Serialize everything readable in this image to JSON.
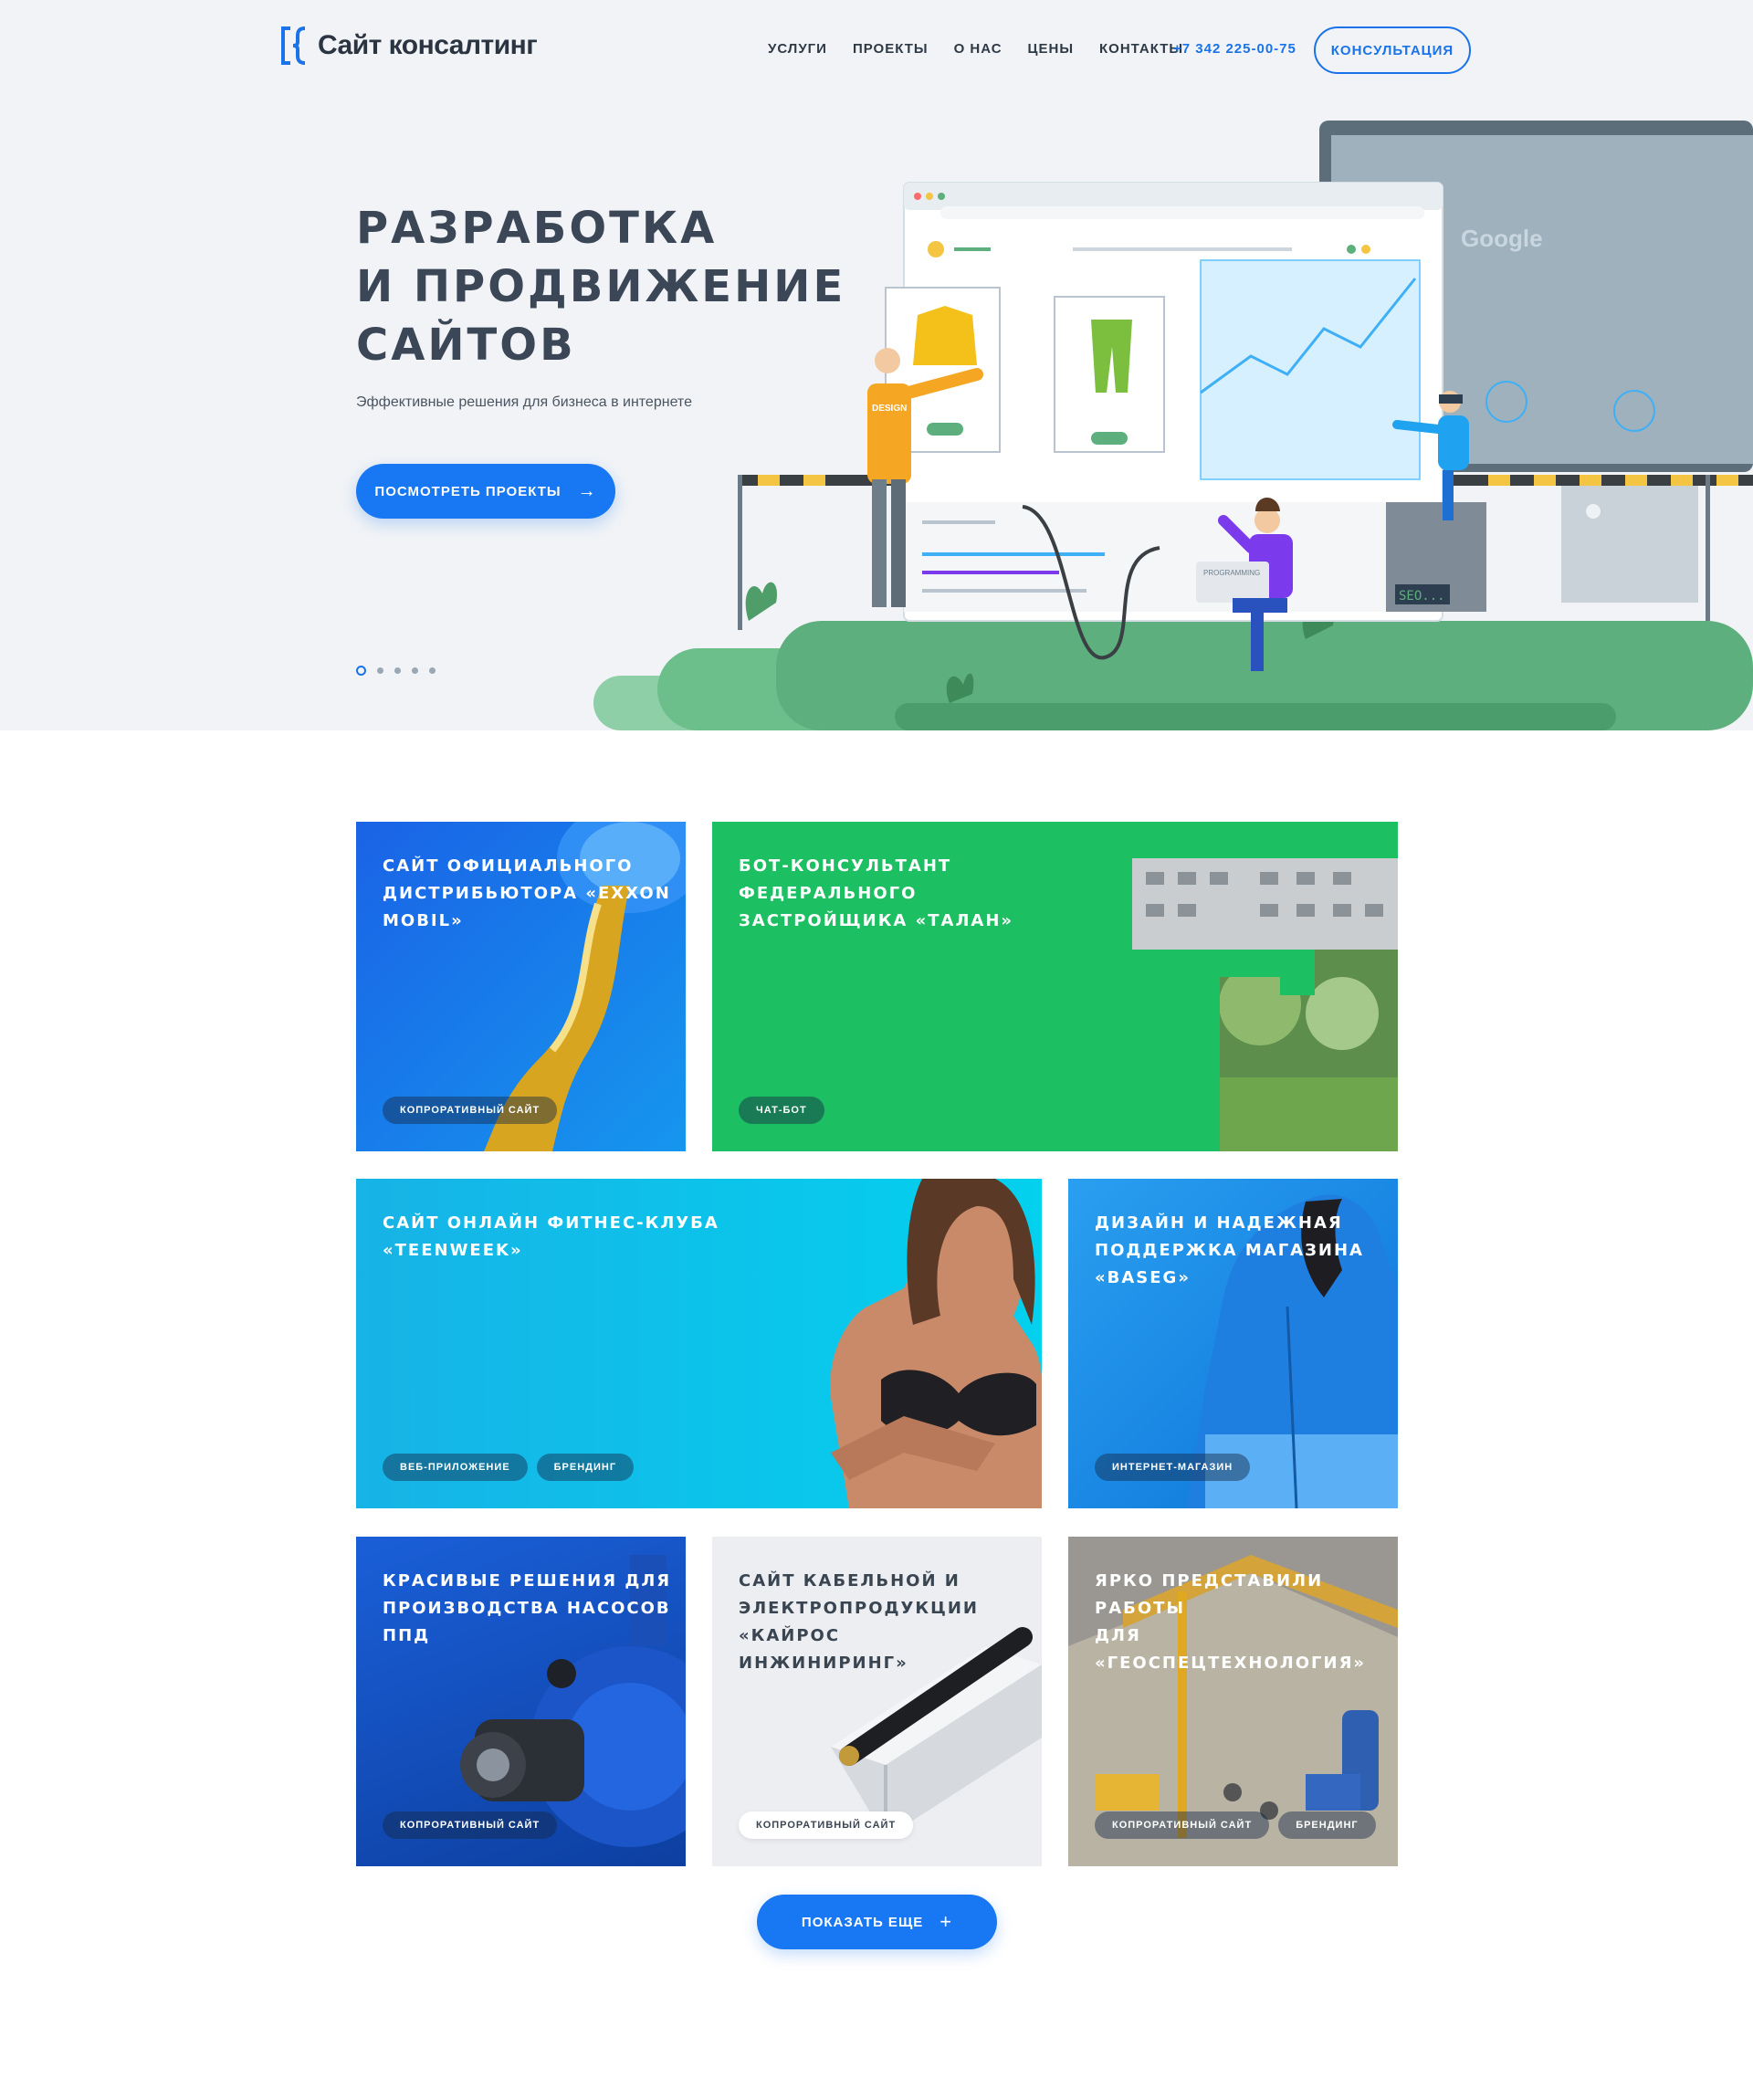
{
  "header": {
    "logo_text": "Сайт консалтинг",
    "nav": [
      "УСЛУГИ",
      "ПРОЕКТЫ",
      "О НАС",
      "ЦЕНЫ",
      "КОНТАКТЫ"
    ],
    "phone": "+7 342 225-00-75",
    "consult_label": "КОНСУЛЬТАЦИЯ"
  },
  "hero": {
    "title_lines": [
      "РАЗРАБОТКА",
      "И ПРОДВИЖЕНИЕ",
      "САЙТОВ"
    ],
    "subtitle": "Эффективные решения для бизнеса в интернете",
    "cta_label": "ПОСМОТРЕТЬ ПРОЕКТЫ",
    "slides_total": 5,
    "active_slide": 1,
    "illustration_text": {
      "shirt_label": "DESIGN",
      "laptop_label": "PROGRAMMING",
      "seo_label": "SEO...",
      "search_brand": "Google"
    }
  },
  "projects": [
    {
      "title": "САЙТ ОФИЦИАЛЬНОГО\nДИСТРИБЬЮТОРА «EXXON\nMOBIL»",
      "tags": [
        "КОПРОРАТИВНЫЙ САЙТ"
      ]
    },
    {
      "title": "БОТ-КОНСУЛЬТАНТ\nФЕДЕРАЛЬНОГО\nЗАСТРОЙЩИКА «ТАЛАН»",
      "tags": [
        "ЧАТ-БОТ"
      ]
    },
    {
      "title": "САЙТ ОНЛАЙН ФИТНЕС-КЛУБА\n«TEENWEEK»",
      "tags": [
        "ВЕБ-ПРИЛОЖЕНИЕ",
        "БРЕНДИНГ"
      ]
    },
    {
      "title": "ДИЗАЙН И НАДЕЖНАЯ\nПОДДЕРЖКА МАГАЗИНА\n«BASEG»",
      "tags": [
        "ИНТЕРНЕТ-МАГАЗИН"
      ]
    },
    {
      "title": "КРАСИВЫЕ РЕШЕНИЯ ДЛЯ\nПРОИЗВОДСТВА НАСОСОВ ППД",
      "tags": [
        "КОПРОРАТИВНЫЙ САЙТ"
      ]
    },
    {
      "title": "САЙТ КАБЕЛЬНОЙ И\nЭЛЕКТРОПРОДУКЦИИ «КАЙРОС\nИНЖИНИРИНГ»",
      "tags": [
        "КОПРОРАТИВНЫЙ САЙТ"
      ]
    },
    {
      "title": "ЯРКО ПРЕДСТАВИЛИ РАБОТЫ\nДЛЯ «ГЕОСПЕЦТЕХНОЛОГИЯ»",
      "tags": [
        "КОПРОРАТИВНЫЙ САЙТ",
        "БРЕНДИНГ"
      ]
    }
  ],
  "more_label": "ПОКАЗАТЬ ЕЩЕ",
  "colors": {
    "accent": "#1877f2",
    "hero_bg": "#f1f3f6",
    "green": "#1cbf61",
    "text_dark": "#3b4756"
  }
}
